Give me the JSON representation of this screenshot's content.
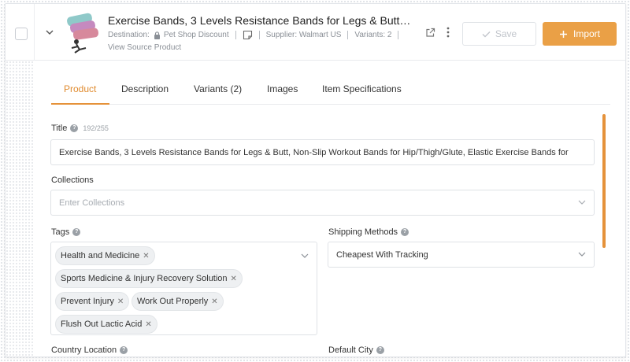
{
  "product": {
    "title": "Exercise Bands, 3 Levels Resistance Bands for Legs & Butt, No...",
    "destination_label": "Destination:",
    "destination_value": "Pet Shop Discount",
    "supplier": "Supplier: Walmart US",
    "variants": "Variants: 2",
    "view_source": "View Source Product"
  },
  "actions": {
    "save_label": "Save",
    "import_label": "Import"
  },
  "tabs": [
    {
      "label": "Product"
    },
    {
      "label": "Description"
    },
    {
      "label": "Variants (2)"
    },
    {
      "label": "Images"
    },
    {
      "label": "Item Specifications"
    }
  ],
  "form": {
    "title_label": "Title",
    "title_count": "192/255",
    "title_value": "Exercise Bands, 3 Levels Resistance Bands for Legs & Butt, Non-Slip Workout Bands for Hip/Thigh/Glute, Elastic Exercise Bands for",
    "collections_label": "Collections",
    "collections_placeholder": "Enter Collections",
    "tags_label": "Tags",
    "tags": [
      "Health and Medicine",
      "Sports Medicine & Injury Recovery Solution",
      "Prevent Injury",
      "Work Out Properly",
      "Flush Out Lactic Acid"
    ],
    "shipping_label": "Shipping Methods",
    "shipping_value": "Cheapest With Tracking",
    "country_label": "Country Location",
    "city_label": "Default City"
  },
  "colors": {
    "accent": "#e5923a",
    "import_button": "#eaa046"
  },
  "icons": {
    "expand": "chevron-down-icon",
    "lock": "lock-icon",
    "note": "note-icon",
    "external": "external-link-icon",
    "more": "more-vertical-icon",
    "check": "check-icon",
    "plus": "plus-icon",
    "help": "help-icon",
    "remove": "close-icon"
  }
}
